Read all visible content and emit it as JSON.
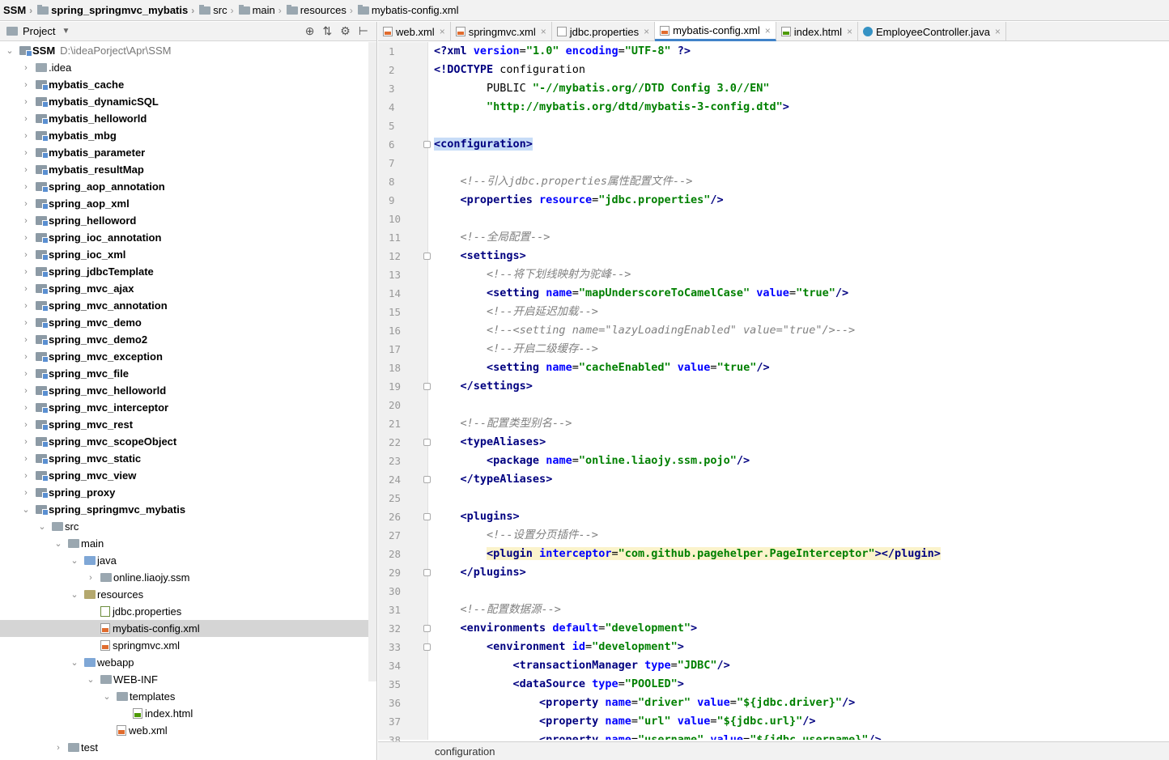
{
  "breadcrumb": [
    "SSM",
    "spring_springmvc_mybatis",
    "src",
    "main",
    "resources",
    "mybatis-config.xml"
  ],
  "project_panel": {
    "title": "Project"
  },
  "tree": [
    {
      "label": "SSM",
      "path": "D:\\ideaPorject\\Apr\\SSM",
      "bold": true,
      "level": 0,
      "arrow": "open",
      "icon": "mod"
    },
    {
      "label": ".idea",
      "level": 1,
      "arrow": "closed",
      "icon": "folder"
    },
    {
      "label": "mybatis_cache",
      "bold": true,
      "level": 1,
      "arrow": "closed",
      "icon": "mod"
    },
    {
      "label": "mybatis_dynamicSQL",
      "bold": true,
      "level": 1,
      "arrow": "closed",
      "icon": "mod"
    },
    {
      "label": "mybatis_helloworld",
      "bold": true,
      "level": 1,
      "arrow": "closed",
      "icon": "mod"
    },
    {
      "label": "mybatis_mbg",
      "bold": true,
      "level": 1,
      "arrow": "closed",
      "icon": "mod"
    },
    {
      "label": "mybatis_parameter",
      "bold": true,
      "level": 1,
      "arrow": "closed",
      "icon": "mod"
    },
    {
      "label": "mybatis_resultMap",
      "bold": true,
      "level": 1,
      "arrow": "closed",
      "icon": "mod"
    },
    {
      "label": "spring_aop_annotation",
      "bold": true,
      "level": 1,
      "arrow": "closed",
      "icon": "mod"
    },
    {
      "label": "spring_aop_xml",
      "bold": true,
      "level": 1,
      "arrow": "closed",
      "icon": "mod"
    },
    {
      "label": "spring_helloword",
      "bold": true,
      "level": 1,
      "arrow": "closed",
      "icon": "mod"
    },
    {
      "label": "spring_ioc_annotation",
      "bold": true,
      "level": 1,
      "arrow": "closed",
      "icon": "mod"
    },
    {
      "label": "spring_ioc_xml",
      "bold": true,
      "level": 1,
      "arrow": "closed",
      "icon": "mod"
    },
    {
      "label": "spring_jdbcTemplate",
      "bold": true,
      "level": 1,
      "arrow": "closed",
      "icon": "mod"
    },
    {
      "label": "spring_mvc_ajax",
      "bold": true,
      "level": 1,
      "arrow": "closed",
      "icon": "mod"
    },
    {
      "label": "spring_mvc_annotation",
      "bold": true,
      "level": 1,
      "arrow": "closed",
      "icon": "mod"
    },
    {
      "label": "spring_mvc_demo",
      "bold": true,
      "level": 1,
      "arrow": "closed",
      "icon": "mod"
    },
    {
      "label": "spring_mvc_demo2",
      "bold": true,
      "level": 1,
      "arrow": "closed",
      "icon": "mod"
    },
    {
      "label": "spring_mvc_exception",
      "bold": true,
      "level": 1,
      "arrow": "closed",
      "icon": "mod"
    },
    {
      "label": "spring_mvc_file",
      "bold": true,
      "level": 1,
      "arrow": "closed",
      "icon": "mod"
    },
    {
      "label": "spring_mvc_helloworld",
      "bold": true,
      "level": 1,
      "arrow": "closed",
      "icon": "mod"
    },
    {
      "label": "spring_mvc_interceptor",
      "bold": true,
      "level": 1,
      "arrow": "closed",
      "icon": "mod"
    },
    {
      "label": "spring_mvc_rest",
      "bold": true,
      "level": 1,
      "arrow": "closed",
      "icon": "mod"
    },
    {
      "label": "spring_mvc_scopeObject",
      "bold": true,
      "level": 1,
      "arrow": "closed",
      "icon": "mod"
    },
    {
      "label": "spring_mvc_static",
      "bold": true,
      "level": 1,
      "arrow": "closed",
      "icon": "mod"
    },
    {
      "label": "spring_mvc_view",
      "bold": true,
      "level": 1,
      "arrow": "closed",
      "icon": "mod"
    },
    {
      "label": "spring_proxy",
      "bold": true,
      "level": 1,
      "arrow": "closed",
      "icon": "mod"
    },
    {
      "label": "spring_springmvc_mybatis",
      "bold": true,
      "level": 1,
      "arrow": "open",
      "icon": "mod"
    },
    {
      "label": "src",
      "level": 2,
      "arrow": "open",
      "icon": "folder"
    },
    {
      "label": "main",
      "level": 3,
      "arrow": "open",
      "icon": "folder"
    },
    {
      "label": "java",
      "level": 4,
      "arrow": "open",
      "icon": "src"
    },
    {
      "label": "online.liaojy.ssm",
      "level": 5,
      "arrow": "closed",
      "icon": "pkg"
    },
    {
      "label": "resources",
      "level": 4,
      "arrow": "open",
      "icon": "res"
    },
    {
      "label": "jdbc.properties",
      "level": 5,
      "arrow": "none",
      "icon": "props"
    },
    {
      "label": "mybatis-config.xml",
      "level": 5,
      "arrow": "none",
      "icon": "xml",
      "selected": true
    },
    {
      "label": "springmvc.xml",
      "level": 5,
      "arrow": "none",
      "icon": "xml"
    },
    {
      "label": "webapp",
      "level": 4,
      "arrow": "open",
      "icon": "web"
    },
    {
      "label": "WEB-INF",
      "level": 5,
      "arrow": "open",
      "icon": "folder"
    },
    {
      "label": "templates",
      "level": 6,
      "arrow": "open",
      "icon": "folder"
    },
    {
      "label": "index.html",
      "level": 7,
      "arrow": "none",
      "icon": "html"
    },
    {
      "label": "web.xml",
      "level": 6,
      "arrow": "none",
      "icon": "xml"
    },
    {
      "label": "test",
      "level": 3,
      "arrow": "closed",
      "icon": "folder"
    }
  ],
  "tabs": [
    {
      "label": "web.xml",
      "icon": "xml"
    },
    {
      "label": "springmvc.xml",
      "icon": "xml"
    },
    {
      "label": "jdbc.properties",
      "icon": "props"
    },
    {
      "label": "mybatis-config.xml",
      "icon": "xml",
      "active": true
    },
    {
      "label": "index.html",
      "icon": "html"
    },
    {
      "label": "EmployeeController.java",
      "icon": "java"
    }
  ],
  "code_lines": [
    "<?xml version=\"1.0\" encoding=\"UTF-8\" ?>",
    "<!DOCTYPE configuration",
    "        PUBLIC \"-//mybatis.org//DTD Config 3.0//EN\"",
    "        \"http://mybatis.org/dtd/mybatis-3-config.dtd\">",
    "",
    "<configuration>",
    "",
    "    <!--引入jdbc.properties属性配置文件-->",
    "    <properties resource=\"jdbc.properties\"/>",
    "",
    "    <!--全局配置-->",
    "    <settings>",
    "        <!--将下划线映射为驼峰-->",
    "        <setting name=\"mapUnderscoreToCamelCase\" value=\"true\"/>",
    "        <!--开启延迟加载-->",
    "        <!--<setting name=\"lazyLoadingEnabled\" value=\"true\"/>-->",
    "        <!--开启二级缓存-->",
    "        <setting name=\"cacheEnabled\" value=\"true\"/>",
    "    </settings>",
    "",
    "    <!--配置类型别名-->",
    "    <typeAliases>",
    "        <package name=\"online.liaojy.ssm.pojo\"/>",
    "    </typeAliases>",
    "",
    "    <plugins>",
    "        <!--设置分页插件-->",
    "        <plugin interceptor=\"com.github.pagehelper.PageInterceptor\"></plugin>",
    "    </plugins>",
    "",
    "    <!--配置数据源-->",
    "    <environments default=\"development\">",
    "        <environment id=\"development\">",
    "            <transactionManager type=\"JDBC\"/>",
    "            <dataSource type=\"POOLED\">",
    "                <property name=\"driver\" value=\"${jdbc.driver}\"/>",
    "                <property name=\"url\" value=\"${jdbc.url}\"/>",
    "                <property name=\"username\" value=\"${jdbc.username}\"/>"
  ],
  "fold_lines": [
    6,
    12,
    19,
    22,
    24,
    26,
    29,
    32,
    33
  ],
  "status": {
    "path": "configuration"
  }
}
